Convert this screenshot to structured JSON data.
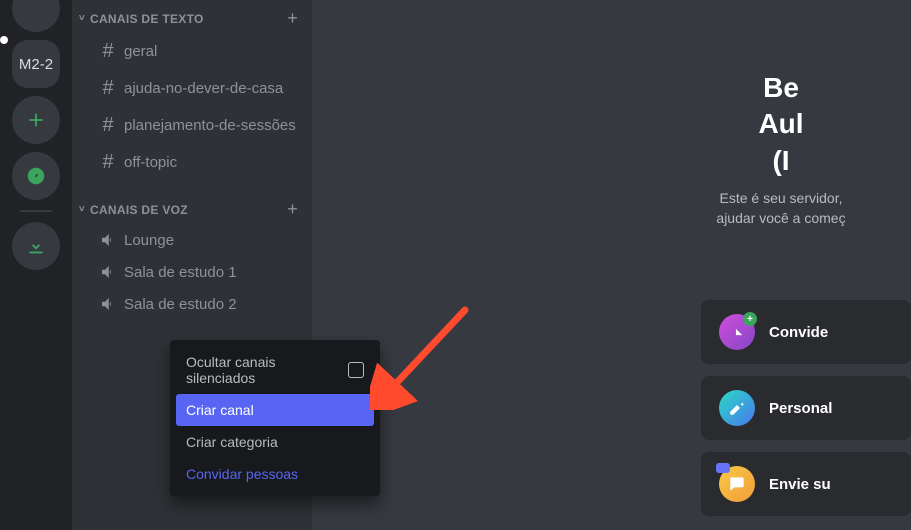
{
  "rail": {
    "server_label": "M2-2"
  },
  "sidebar": {
    "text_cat": "CANAIS DE TEXTO",
    "voice_cat": "CANAIS DE VOZ",
    "text_channels": [
      "geral",
      "ajuda-no-dever-de-casa",
      "planejamento-de-sessões",
      "off-topic"
    ],
    "voice_channels": [
      "Lounge",
      "Sala de estudo 1",
      "Sala de estudo 2"
    ]
  },
  "context_menu": {
    "mute": "Ocultar canais silenciados",
    "create_channel": "Criar canal",
    "create_category": "Criar categoria",
    "invite": "Convidar pessoas"
  },
  "welcome": {
    "line1": "Be",
    "line2": "Aul",
    "line3": "(I",
    "desc1": "Este é seu servidor,",
    "desc2": "ajudar você a começ"
  },
  "cards": {
    "invite": "Convide",
    "personalize": "Personal",
    "send": "Envie su"
  }
}
